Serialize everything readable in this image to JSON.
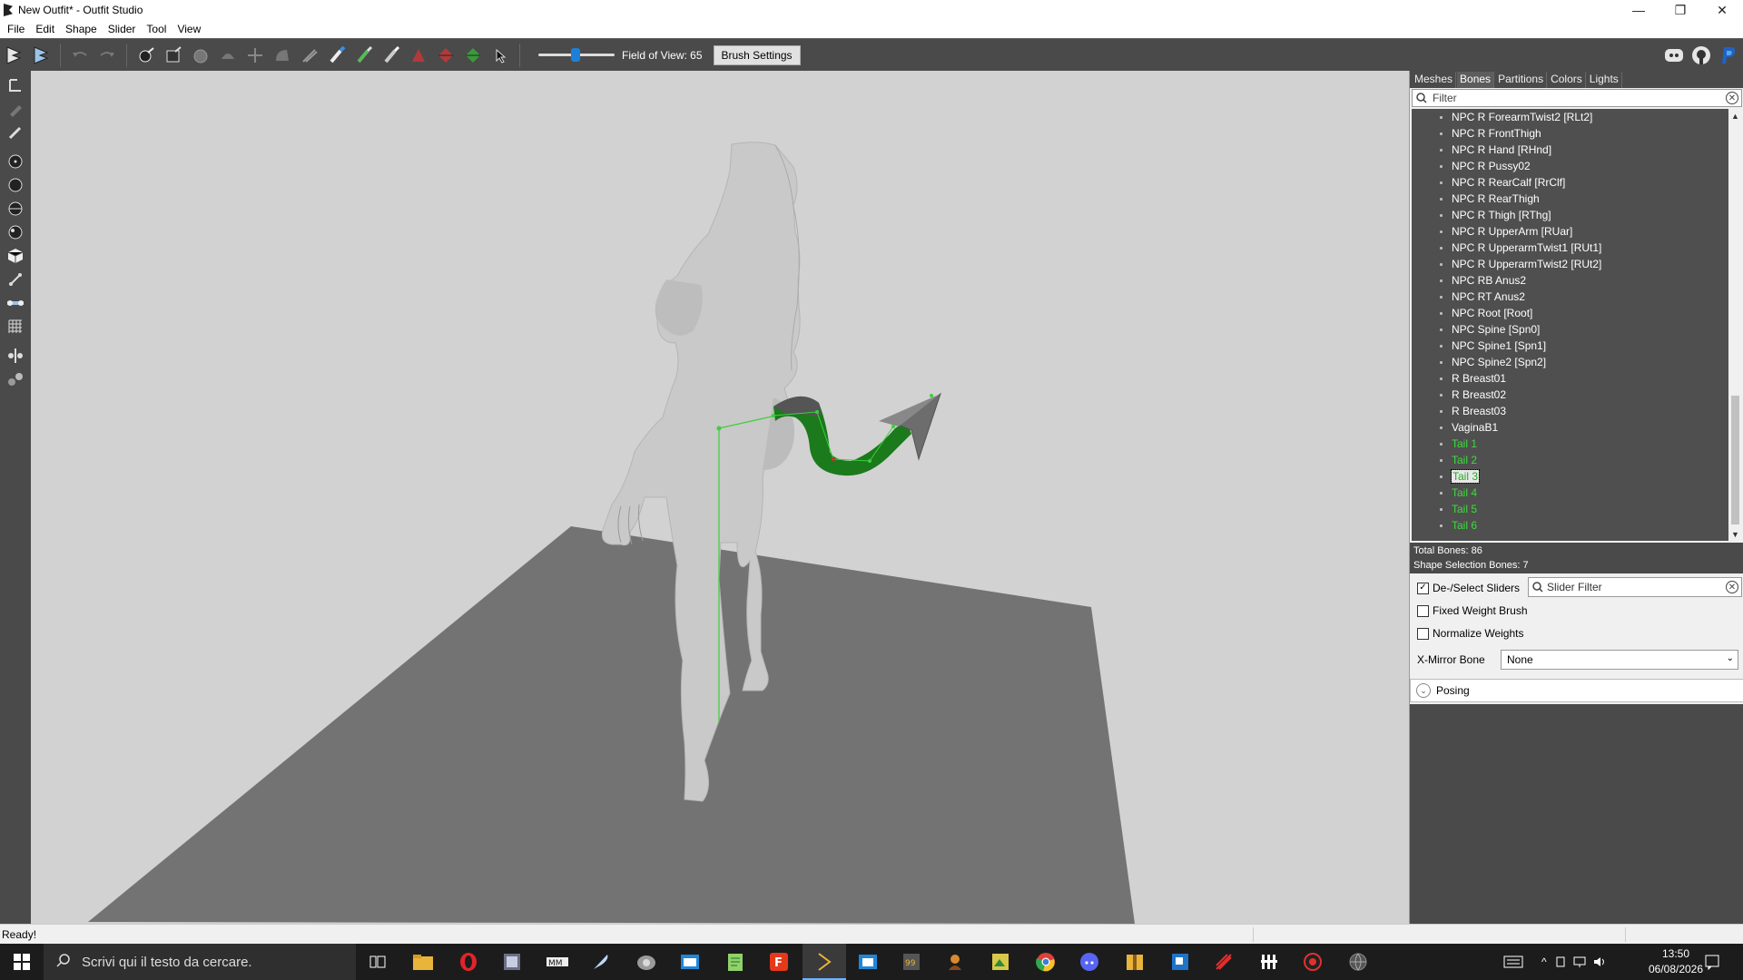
{
  "window": {
    "title": "New Outfit* - Outfit Studio",
    "minimize": "—",
    "restore": "❐",
    "close": "✕"
  },
  "menu": [
    "File",
    "Edit",
    "Shape",
    "Slider",
    "Tool",
    "View"
  ],
  "toolbar": {
    "fov_label": "Field of View: 65",
    "fov_value": 65,
    "brush_settings_label": "Brush Settings"
  },
  "right_panel": {
    "tabs": [
      "Meshes",
      "Bones",
      "Partitions",
      "Colors",
      "Lights"
    ],
    "active_tab": "Bones",
    "filter_placeholder": "Filter",
    "bones": [
      {
        "name": "NPC R ForearmTwist2 [RLt2]",
        "green": false
      },
      {
        "name": "NPC R FrontThigh",
        "green": false
      },
      {
        "name": "NPC R Hand [RHnd]",
        "green": false
      },
      {
        "name": "NPC R Pussy02",
        "green": false
      },
      {
        "name": "NPC R RearCalf [RrClf]",
        "green": false
      },
      {
        "name": "NPC R RearThigh",
        "green": false
      },
      {
        "name": "NPC R Thigh [RThg]",
        "green": false
      },
      {
        "name": "NPC R UpperArm [RUar]",
        "green": false
      },
      {
        "name": "NPC R UpperarmTwist1 [RUt1]",
        "green": false
      },
      {
        "name": "NPC R UpperarmTwist2 [RUt2]",
        "green": false
      },
      {
        "name": "NPC RB Anus2",
        "green": false
      },
      {
        "name": "NPC RT Anus2",
        "green": false
      },
      {
        "name": "NPC Root [Root]",
        "green": false
      },
      {
        "name": "NPC Spine [Spn0]",
        "green": false
      },
      {
        "name": "NPC Spine1 [Spn1]",
        "green": false
      },
      {
        "name": "NPC Spine2 [Spn2]",
        "green": false
      },
      {
        "name": "R Breast01",
        "green": false
      },
      {
        "name": "R Breast02",
        "green": false
      },
      {
        "name": "R Breast03",
        "green": false
      },
      {
        "name": "VaginaB1",
        "green": false
      },
      {
        "name": "Tail 1",
        "green": true
      },
      {
        "name": "Tail 2",
        "green": true
      },
      {
        "name": "Tail 3",
        "green": true,
        "selected": true
      },
      {
        "name": "Tail 4",
        "green": true
      },
      {
        "name": "Tail 5",
        "green": true
      },
      {
        "name": "Tail 6",
        "green": true
      }
    ],
    "total_bones": "Total Bones: 86",
    "shape_selection_bones": "Shape Selection Bones: 7",
    "deselect_sliders_label": "De-/Select Sliders",
    "deselect_sliders_checked": true,
    "slider_filter_placeholder": "Slider Filter",
    "fixed_weight_brush_label": "Fixed Weight Brush",
    "fixed_weight_brush_checked": false,
    "normalize_weights_label": "Normalize Weights",
    "normalize_weights_checked": false,
    "x_mirror_label": "X-Mirror Bone",
    "x_mirror_value": "None",
    "posing_label": "Posing"
  },
  "status": {
    "text": "Ready!"
  },
  "taskbar": {
    "search_placeholder": "Scrivi qui il testo da cercare.",
    "time": "13:50",
    "date": "06/08/2026"
  },
  "colors": {
    "accent_blue": "#1e7fd8",
    "bone_green": "#3ddc3d",
    "toolbar_bg": "#4a4a4a",
    "viewport_bg": "#d2d2d2",
    "floor": "#737373"
  },
  "icons": {
    "search": "search-icon",
    "discord": "discord-icon",
    "github": "github-icon",
    "paypal": "paypal-icon"
  }
}
